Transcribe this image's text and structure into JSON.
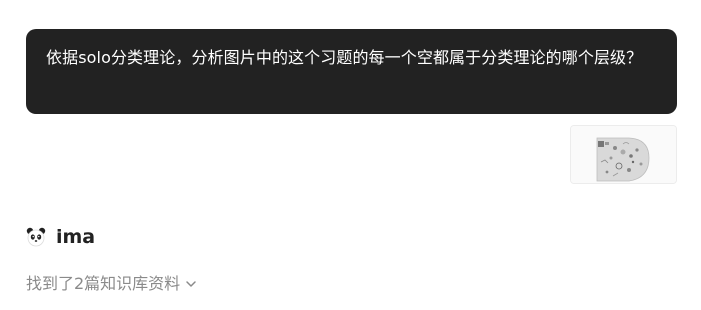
{
  "conversation": {
    "user_message": {
      "text": "依据solo分类理论，分析图片中的这个习题的每一个空都属于分类理论的哪个层级？",
      "attachment": {
        "icon": "image-thumbnail"
      }
    },
    "assistant": {
      "name": "ima",
      "avatar_icon": "panda-icon",
      "knowledge_base_summary": "找到了2篇知识库资料",
      "expand_icon": "chevron-down-icon"
    }
  },
  "colors": {
    "user_bubble_bg": "#222222",
    "user_bubble_text": "#ffffff",
    "assistant_name": "#222222",
    "muted_text": "#8a8a8a"
  }
}
